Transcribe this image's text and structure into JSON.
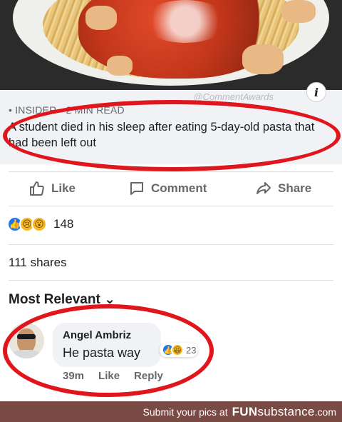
{
  "post_image": {
    "watermark": "@CommentAwards",
    "info_icon": "info-icon"
  },
  "link_card": {
    "source": "• INSIDER • 2 MIN READ",
    "headline": "A student died in his sleep after eating 5-day-old pasta that had been left out"
  },
  "actions": {
    "like_label": "Like",
    "comment_label": "Comment",
    "share_label": "Share"
  },
  "reactions": {
    "icons": [
      "like-icon",
      "sad-icon",
      "wow-icon"
    ],
    "count": "148"
  },
  "shares": "111 shares",
  "comments_filter": "Most Relevant ⌄",
  "comment": {
    "author": "Angel Ambriz",
    "text": "He pasta way",
    "reaction_icons": [
      "like-icon",
      "haha-icon"
    ],
    "reaction_count": "23",
    "time": "39m",
    "like_label": "Like",
    "reply_label": "Reply"
  },
  "footer": {
    "text": "Submit your pics at",
    "brand_bold": "FUN",
    "brand_rest": "substance",
    "tld": ".com"
  },
  "colors": {
    "highlight_red": "#e0161c",
    "facebook_blue": "#1877f2",
    "footer_bg": "#7a4a44"
  }
}
